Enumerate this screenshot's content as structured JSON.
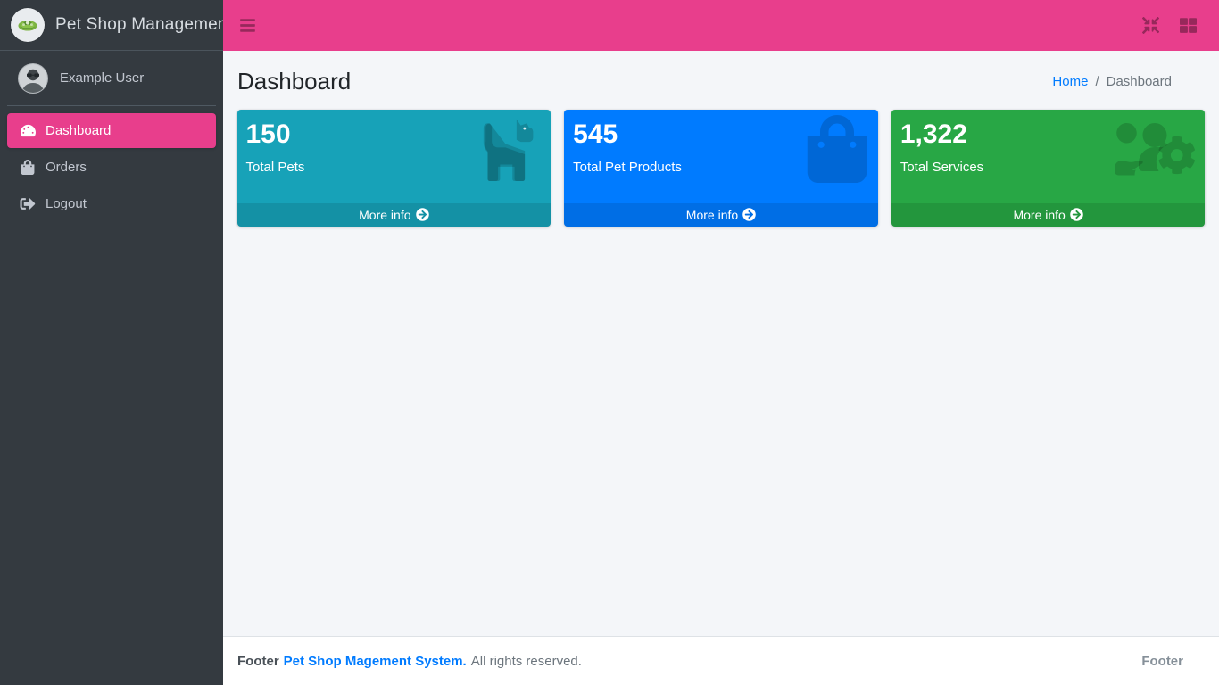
{
  "sidebar": {
    "brand": {
      "title": "Pet Shop Management",
      "logo_icon": "pet-logo-icon"
    },
    "user": {
      "name": "Example User",
      "avatar_icon": "user-avatar-photo"
    },
    "items": [
      {
        "label": "Dashboard",
        "icon": "tachometer-icon",
        "active": true
      },
      {
        "label": "Orders",
        "icon": "shopping-bag-icon",
        "active": false
      },
      {
        "label": "Logout",
        "icon": "sign-out-icon",
        "active": false
      }
    ]
  },
  "navbar": {
    "menu_toggle_icon": "hamburger-menu-icon",
    "fullscreen_icon": "compress-arrows-icon",
    "apps_icon": "th-large-grid-icon",
    "background_color": "#e83e8c"
  },
  "header": {
    "title": "Dashboard",
    "breadcrumb": {
      "home_label": "Home",
      "separator": "/",
      "current_label": "Dashboard"
    }
  },
  "cards": [
    {
      "value": "150",
      "label": "Total Pets",
      "footer_label": "More info",
      "footer_icon": "circle-arrow-right-icon",
      "icon": "dog-icon",
      "color": "#17a2b8"
    },
    {
      "value": "545",
      "label": "Total Pet Products",
      "footer_label": "More info",
      "footer_icon": "circle-arrow-right-icon",
      "icon": "shopping-bag-icon",
      "color": "#007bff"
    },
    {
      "value": "1,322",
      "label": "Total Services",
      "footer_label": "More info",
      "footer_icon": "circle-arrow-right-icon",
      "icon": "users-cog-icon",
      "color": "#28a745"
    }
  ],
  "footer": {
    "prefix": "Footer",
    "brand": "Pet Shop Magement System.",
    "rights": "All rights reserved.",
    "right_label": "Footer"
  }
}
